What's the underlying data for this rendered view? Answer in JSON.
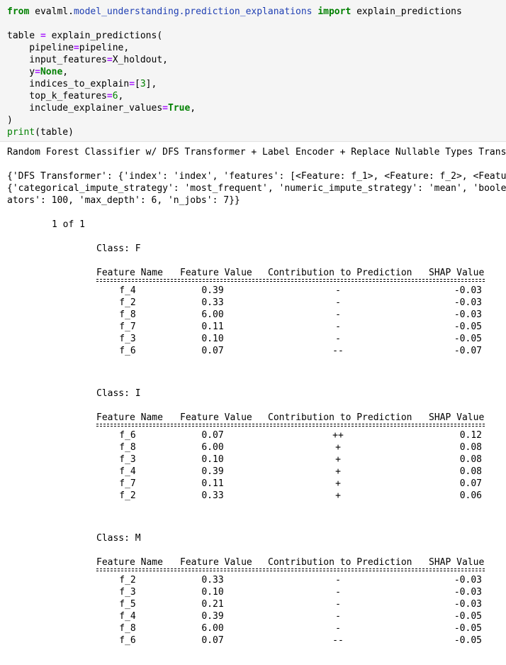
{
  "code": {
    "line1": {
      "kw_from": "from",
      "mod_pre": "evalml.",
      "mod": "model_understanding.prediction_explanations",
      "kw_import": "import",
      "name": "explain_predictions"
    },
    "line3": {
      "text": "table ",
      "op": "=",
      "rest": " explain_predictions("
    },
    "args": [
      {
        "name": "    pipeline",
        "op": "=",
        "val": "pipeline,",
        "val_class": ""
      },
      {
        "name": "    input_features",
        "op": "=",
        "val": "X_holdout,",
        "val_class": ""
      },
      {
        "name": "    y",
        "op": "=",
        "val": "None",
        "val_class": "k",
        "tail": ","
      },
      {
        "name": "    indices_to_explain",
        "op": "=",
        "val": "[",
        "val_class": "",
        "num": "3",
        "tail": "],"
      },
      {
        "name": "    top_k_features",
        "op": "=",
        "val": "",
        "val_class": "",
        "num": "6",
        "tail": ","
      },
      {
        "name": "    include_explainer_values",
        "op": "=",
        "val": "True",
        "val_class": "k",
        "tail": ","
      }
    ],
    "close": ")",
    "print_fn": "print",
    "print_arg": "(table)"
  },
  "output": {
    "pipeline_name": "Random Forest Classifier w/ DFS Transformer + Label Encoder + Replace Nullable Types Trans",
    "params_line1": "{'DFS Transformer': {'index': 'index', 'features': [<Feature: f_1>, <Feature: f_2>, <Featu",
    "params_line2": "{'categorical_impute_strategy': 'most_frequent', 'numeric_impute_strategy': 'mean', 'boole",
    "params_line3": "ators': 100, 'max_depth': 6, 'n_jobs': 7}}",
    "counter": "1 of 1",
    "headers": {
      "name": "Feature Name",
      "value": "Feature Value",
      "contrib": "Contribution to Prediction",
      "shap": "SHAP Value"
    },
    "tables": [
      {
        "class_label": "Class: F",
        "rows": [
          {
            "name": "f_4",
            "value": "0.39",
            "contrib": "-",
            "shap": "-0.03"
          },
          {
            "name": "f_2",
            "value": "0.33",
            "contrib": "-",
            "shap": "-0.03"
          },
          {
            "name": "f_8",
            "value": "6.00",
            "contrib": "-",
            "shap": "-0.03"
          },
          {
            "name": "f_7",
            "value": "0.11",
            "contrib": "-",
            "shap": "-0.05"
          },
          {
            "name": "f_3",
            "value": "0.10",
            "contrib": "-",
            "shap": "-0.05"
          },
          {
            "name": "f_6",
            "value": "0.07",
            "contrib": "--",
            "shap": "-0.07"
          }
        ]
      },
      {
        "class_label": "Class: I",
        "rows": [
          {
            "name": "f_6",
            "value": "0.07",
            "contrib": "++",
            "shap": "0.12"
          },
          {
            "name": "f_8",
            "value": "6.00",
            "contrib": "+",
            "shap": "0.08"
          },
          {
            "name": "f_3",
            "value": "0.10",
            "contrib": "+",
            "shap": "0.08"
          },
          {
            "name": "f_4",
            "value": "0.39",
            "contrib": "+",
            "shap": "0.08"
          },
          {
            "name": "f_7",
            "value": "0.11",
            "contrib": "+",
            "shap": "0.07"
          },
          {
            "name": "f_2",
            "value": "0.33",
            "contrib": "+",
            "shap": "0.06"
          }
        ]
      },
      {
        "class_label": "Class: M",
        "rows": [
          {
            "name": "f_2",
            "value": "0.33",
            "contrib": "-",
            "shap": "-0.03"
          },
          {
            "name": "f_3",
            "value": "0.10",
            "contrib": "-",
            "shap": "-0.03"
          },
          {
            "name": "f_5",
            "value": "0.21",
            "contrib": "-",
            "shap": "-0.03"
          },
          {
            "name": "f_4",
            "value": "0.39",
            "contrib": "-",
            "shap": "-0.05"
          },
          {
            "name": "f_8",
            "value": "6.00",
            "contrib": "-",
            "shap": "-0.05"
          },
          {
            "name": "f_6",
            "value": "0.07",
            "contrib": "--",
            "shap": "-0.05"
          }
        ]
      }
    ]
  }
}
